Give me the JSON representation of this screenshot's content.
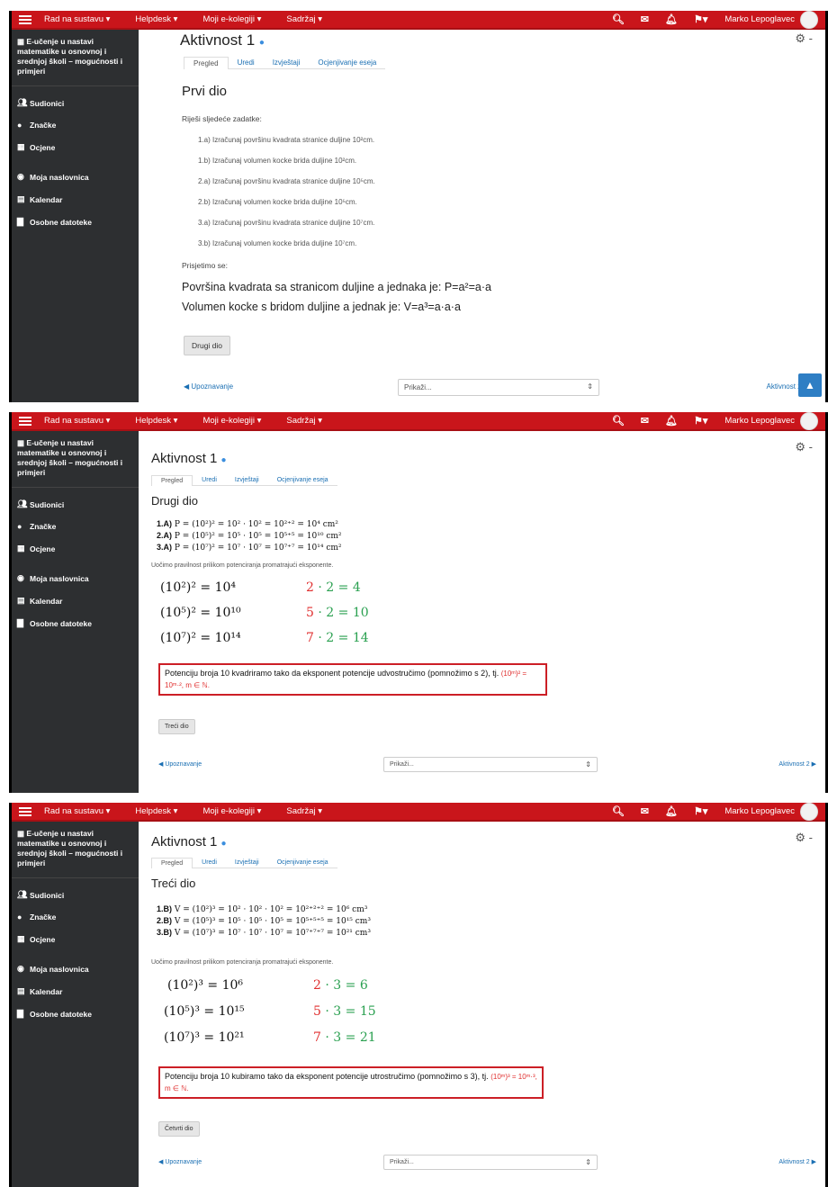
{
  "topbar": {
    "nav": [
      "Rad na sustavu ▾",
      "Helpdesk ▾",
      "Moji e-kolegiji ▾",
      "Sadržaj ▾"
    ],
    "user": "Marko Lepoglavec"
  },
  "sidebar": {
    "course": "E-učenje u nastavi matematike u osnovnoj i srednjoj školi – mogućnosti i primjeri",
    "items": [
      "Sudionici",
      "Značke",
      "Ocjene"
    ],
    "items2": [
      "Moja naslovnica",
      "Kalendar",
      "Osobne datoteke"
    ]
  },
  "activity": {
    "title": "Aktivnost 1",
    "tabs": [
      "Pregled",
      "Uredi",
      "Izvještaji",
      "Ocjenjivanje eseja"
    ]
  },
  "part1": {
    "heading": "Prvi dio",
    "intro": "Riješi sljedeće zadatke:",
    "tasks": [
      "1.a) Izračunaj površinu kvadrata stranice duljine 10²cm.",
      "1.b) Izračunaj volumen kocke brida duljine 10²cm.",
      "2.a) Izračunaj površinu kvadrata stranice duljine 10⁵cm.",
      "2.b) Izračunaj volumen kocke brida duljine 10⁵cm.",
      "3.a) Izračunaj površinu kvadrata stranice duljine 10⁷cm.",
      "3.b) Izračunaj volumen kocke brida duljine 10⁷cm."
    ],
    "remember": "Prisjetimo se:",
    "formula1": "Površina kvadrata sa stranicom duljine a jednaka je: P=a²=a·a",
    "formula2": "Volumen kocke s bridom duljine a jednak je: V=a³=a·a·a",
    "next_button": "Drugi dio"
  },
  "part2": {
    "heading": "Drugi dio",
    "eqs": [
      {
        "label": "1.A)",
        "text": " P = (10²)² = 10² · 10² = 10²⁺² = 10⁴ cm²"
      },
      {
        "label": "2.A)",
        "text": " P = (10⁵)² = 10⁵ · 10⁵ = 10⁵⁺⁵ = 10¹⁰ cm²"
      },
      {
        "label": "3.A)",
        "text": " P = (10⁷)² = 10⁷ · 10⁷ = 10⁷⁺⁷ = 10¹⁴ cm²"
      }
    ],
    "note": "Uočimo pravilnost prilikom potenciranja promatrajući eksponente.",
    "powers": [
      "(10²)² = 10⁴",
      "(10⁵)² = 10¹⁰",
      "(10⁷)² = 10¹⁴"
    ],
    "mults": [
      [
        "2",
        "· 2 = 4"
      ],
      [
        "5",
        "· 2 = 10"
      ],
      [
        "7",
        "· 2 = 14"
      ]
    ],
    "rule": "Potenciju broja 10 kvadriramo tako da eksponent potencije udvostručimo (pomnožimo s 2), tj.",
    "rule_formula": "(10ᵐ)² = 10ᵐ·², m ∈ ℕ.",
    "next_button": "Treći dio"
  },
  "part3": {
    "heading": "Treći dio",
    "eqs": [
      {
        "label": "1.B)",
        "text": " V = (10²)³ = 10² · 10² · 10² = 10²⁺²⁺² = 10⁶ cm³"
      },
      {
        "label": "2.B)",
        "text": " V = (10⁵)³ = 10⁵ · 10⁵ · 10⁵ = 10⁵⁺⁵⁺⁵ = 10¹⁵ cm³"
      },
      {
        "label": "3.B)",
        "text": " V = (10⁷)³ = 10⁷ · 10⁷ · 10⁷ = 10⁷⁺⁷⁺⁷ = 10²¹ cm³"
      }
    ],
    "note": "Uočimo pravilnost prilikom potenciranja promatrajući eksponente.",
    "powers": [
      "(10²)³ = 10⁶",
      "(10⁵)³ = 10¹⁵",
      "(10⁷)³ = 10²¹"
    ],
    "mults": [
      [
        "2",
        "· 3 = 6"
      ],
      [
        "5",
        "· 3 = 15"
      ],
      [
        "7",
        "· 3 = 21"
      ]
    ],
    "rule": "Potenciju broja 10 kubiramo tako da eksponent potencije utrostručimo (pomnožimo s 3), tj.",
    "rule_formula": "(10ᵐ)³ = 10ᵐ·³, m ∈ ℕ.",
    "next_button": "Četvrti dio"
  },
  "footer": {
    "prev": "◀ Upoznavanje",
    "jump": "Prikaži...",
    "next": "Aktivnost 2 ▶"
  },
  "colors": {
    "topbar": "#c9151b",
    "sidebar": "#2d2f31",
    "link": "#1a6fb3",
    "accent_red": "#e03030",
    "accent_green": "#2aa050"
  }
}
